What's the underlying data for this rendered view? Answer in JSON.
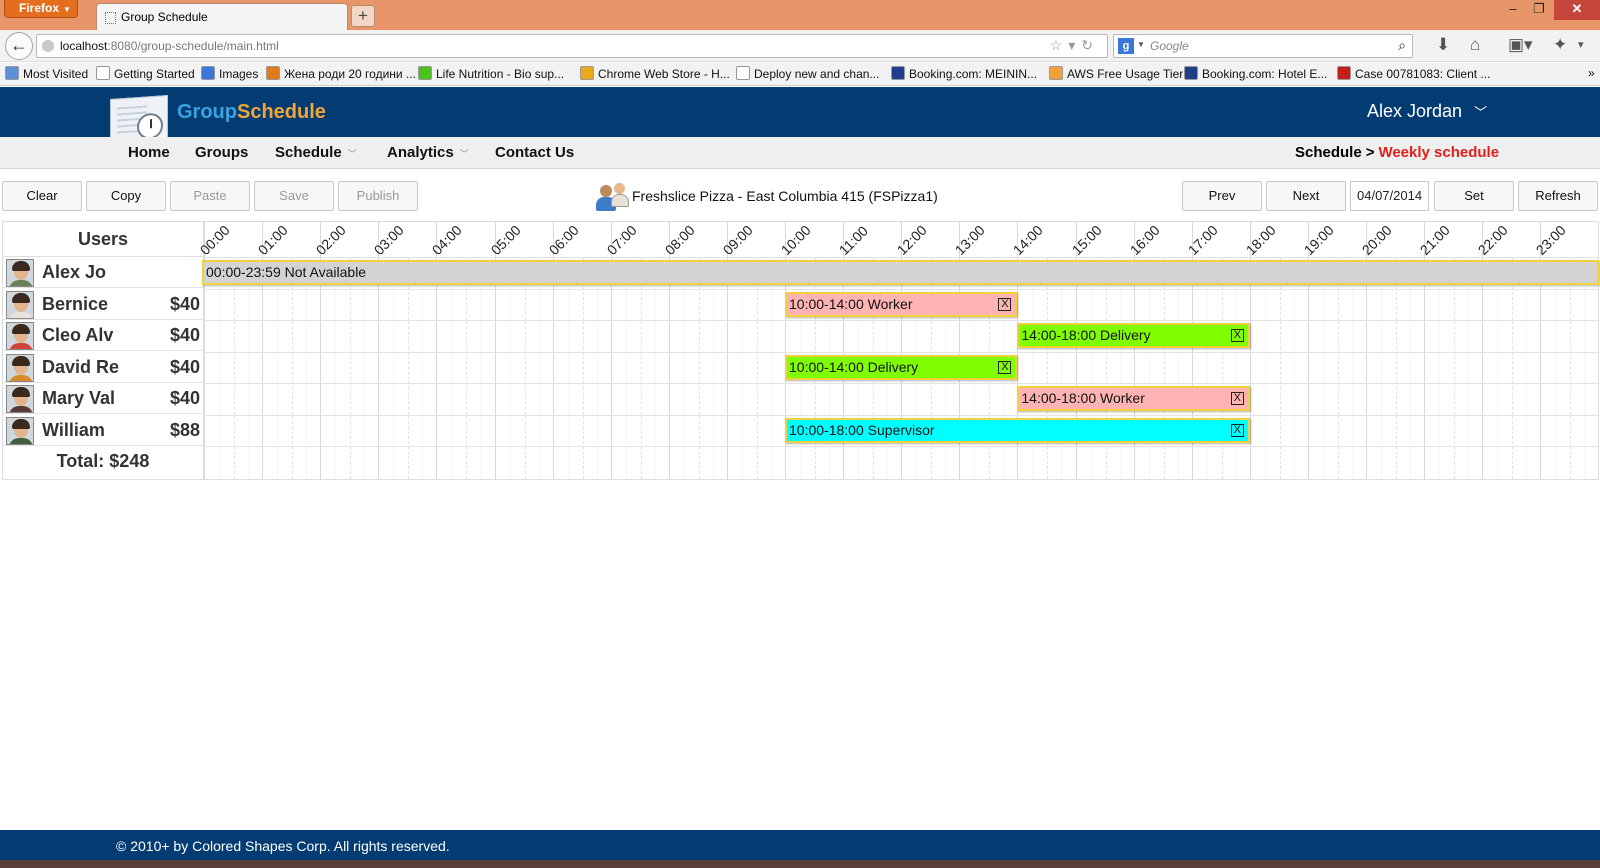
{
  "browser": {
    "menu_button": "Firefox",
    "tab_title": "Group Schedule",
    "new_tab": "+",
    "url_host": "localhost",
    "url_rest": ":8080/group-schedule/main.html",
    "search_placeholder": "Google",
    "search_engine_letter": "g",
    "bookmarks": [
      {
        "label": "Most Visited",
        "color": "#5b8fd6"
      },
      {
        "label": "Getting Started",
        "color": "#ffffff"
      },
      {
        "label": "Images",
        "color": "#3a78d8"
      },
      {
        "label": "Жена роди 20 години ...",
        "color": "#e07a1a"
      },
      {
        "label": "Life Nutrition - Bio sup...",
        "color": "#4cc21f"
      },
      {
        "label": "Chrome Web Store - H...",
        "color": "#e8a91c"
      },
      {
        "label": "Deploy new and chan...",
        "color": "#ffffff"
      },
      {
        "label": "Booking.com: MEININ...",
        "color": "#1f3d8a"
      },
      {
        "label": "AWS Free Usage Tier",
        "color": "#f2a23a"
      },
      {
        "label": "Booking.com: Hotel E...",
        "color": "#1f3d8a"
      },
      {
        "label": "Case 00781083: Client ...",
        "color": "#c71d1d"
      }
    ]
  },
  "app": {
    "brand_part1": "Group",
    "brand_part2": "Schedule",
    "user_name": "Alex  Jordan",
    "menu": [
      "Home",
      "Groups",
      "Schedule",
      "Analytics",
      "Contact Us"
    ],
    "breadcrumb_root": "Schedule",
    "breadcrumb_sep": ">",
    "breadcrumb_current": "Weekly schedule",
    "colors": {
      "header": "#033c73",
      "brand_blue": "#3aa3e0",
      "brand_orange": "#f0a43a",
      "breadcrumb_current": "#e0201c"
    }
  },
  "toolbar": {
    "clear": "Clear",
    "copy": "Copy",
    "paste": "Paste",
    "save": "Save",
    "publish": "Publish",
    "group_name": "Freshslice Pizza - East Columbia 415 (FSPizza1)",
    "prev": "Prev",
    "next": "Next",
    "date": "04/07/2014",
    "set": "Set",
    "refresh": "Refresh"
  },
  "schedule": {
    "users_header": "Users",
    "hours": [
      "00:00",
      "01:00",
      "02:00",
      "03:00",
      "04:00",
      "05:00",
      "06:00",
      "07:00",
      "08:00",
      "09:00",
      "10:00",
      "11:00",
      "12:00",
      "13:00",
      "14:00",
      "15:00",
      "16:00",
      "17:00",
      "18:00",
      "19:00",
      "20:00",
      "21:00",
      "22:00",
      "23:00"
    ],
    "users": [
      {
        "name": "Alex Jo",
        "rate": "",
        "shirt": "#6b7f5a"
      },
      {
        "name": "Bernice",
        "rate": "$40",
        "shirt": "#e9e3da"
      },
      {
        "name": "Cleo Alv",
        "rate": "$40",
        "shirt": "#d0433a"
      },
      {
        "name": "David Re",
        "rate": "$40",
        "shirt": "#d98a2a"
      },
      {
        "name": "Mary Val",
        "rate": "$40",
        "shirt": "#5a3a36"
      },
      {
        "name": "William",
        "rate": "$88",
        "shirt": "#3f5f3a"
      }
    ],
    "total": "Total: $248",
    "shifts": [
      {
        "row": 0,
        "start": 0,
        "end": 24,
        "label": "00:00-23:59 Not Available",
        "color": "#d3d3d3",
        "removable": false
      },
      {
        "row": 1,
        "start": 10,
        "end": 14,
        "label": "10:00-14:00 Worker",
        "color": "#ffb3b3",
        "removable": true
      },
      {
        "row": 2,
        "start": 14,
        "end": 18,
        "label": "14:00-18:00 Delivery",
        "color": "#80ff00",
        "removable": true
      },
      {
        "row": 3,
        "start": 10,
        "end": 14,
        "label": "10:00-14:00 Delivery",
        "color": "#80ff00",
        "removable": true
      },
      {
        "row": 4,
        "start": 14,
        "end": 18,
        "label": "14:00-18:00 Worker",
        "color": "#ffb3b3",
        "removable": true
      },
      {
        "row": 5,
        "start": 10,
        "end": 18,
        "label": "10:00-18:00 Supervisor",
        "color": "#00ffff",
        "removable": true
      }
    ],
    "remove_glyph": "X"
  },
  "footer": {
    "text": "© 2010+ by Colored Shapes Corp. All rights reserved."
  }
}
